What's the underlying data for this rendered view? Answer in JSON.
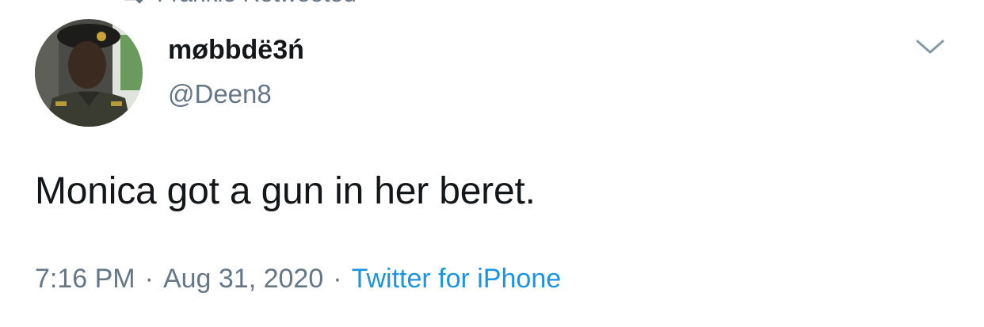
{
  "retweet": {
    "icon": "retweet-icon",
    "text": "Frankie Retweeted"
  },
  "tweet": {
    "author": {
      "display_name": "møbbdë3ń",
      "handle": "@Deen8",
      "avatar_icon": "avatar"
    },
    "caret_icon": "chevron-down-icon",
    "text": "Monica got a gun in her beret.",
    "meta": {
      "time": "7:16 PM",
      "separator": "·",
      "date": "Aug 31, 2020",
      "source": "Twitter for iPhone"
    }
  },
  "colors": {
    "primary_text": "#14171a",
    "secondary_text": "#657786",
    "link": "#1b95e0",
    "background": "#ffffff"
  }
}
